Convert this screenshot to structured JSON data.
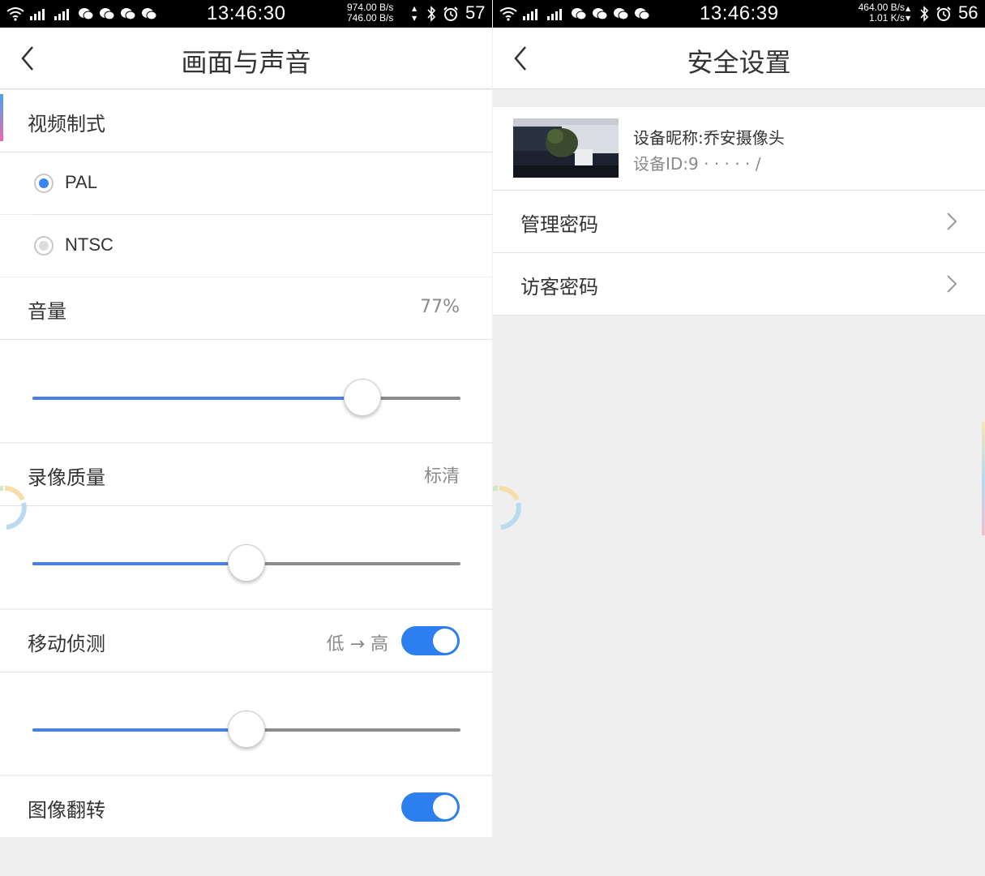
{
  "left": {
    "status": {
      "time": "13:46:30",
      "net_up": "974.00 B/s",
      "net_down": "746.00 B/s",
      "battery": "57"
    },
    "title": "画面与声音",
    "video_format": {
      "label": "视频制式",
      "options": [
        {
          "label": "PAL",
          "selected": true
        },
        {
          "label": "NTSC",
          "selected": false
        }
      ]
    },
    "volume": {
      "label": "音量",
      "value_text": "77%",
      "level": 0.77
    },
    "record_quality": {
      "label": "录像质量",
      "value_text": "标清",
      "level": 0.5
    },
    "motion_detect": {
      "label": "移动侦测",
      "range_text": "低 → 高",
      "enabled": true,
      "level": 0.5
    },
    "image_flip": {
      "label": "图像翻转",
      "enabled": true
    }
  },
  "right": {
    "status": {
      "time": "13:46:39",
      "net_up": "464.00 B/s",
      "net_down": "1.01 K/s",
      "battery": "56"
    },
    "title": "安全设置",
    "device": {
      "nickname": "设备昵称:乔安摄像头",
      "id_text": "设备ID:9 · ·  · · · /"
    },
    "items": [
      {
        "label": "管理密码"
      },
      {
        "label": "访客密码"
      }
    ]
  },
  "colors": {
    "accent_blue": "#2d7ff0",
    "slider_fill": "#4a7fe6",
    "background": "#efefef"
  }
}
